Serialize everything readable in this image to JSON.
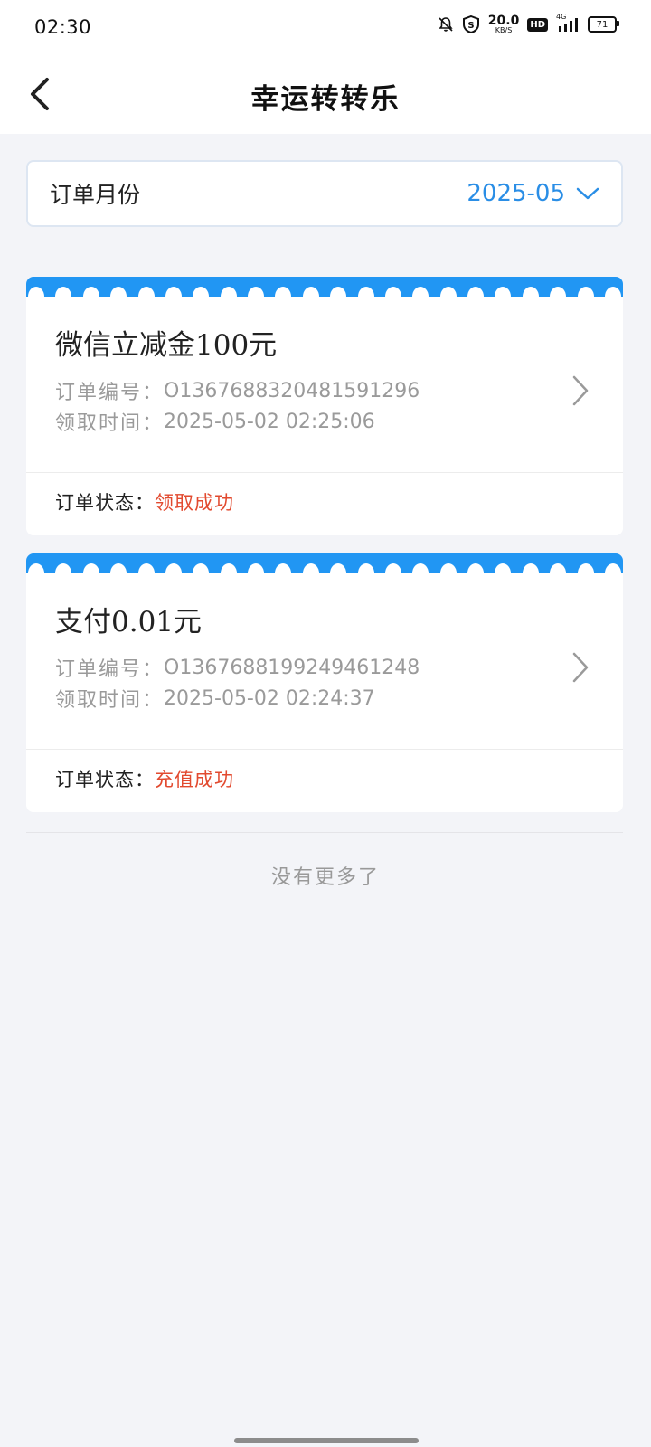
{
  "status_bar": {
    "time": "02:30",
    "net_speed_value": "20.0",
    "net_speed_unit": "KB/S",
    "hd_label": "HD",
    "network_label": "4G",
    "battery_level": "71",
    "icons": [
      "bell-off-icon",
      "shield-s-icon",
      "hd-icon",
      "signal-icon",
      "battery-icon"
    ]
  },
  "header": {
    "title": "幸运转转乐",
    "back_icon": "chevron-left-icon"
  },
  "month_filter": {
    "label": "订单月份",
    "value": "2025-05",
    "icon": "chevron-down-icon"
  },
  "orders": [
    {
      "title": "微信立减金100元",
      "order_no_label": "订单编号：",
      "order_no": "O1367688320481591296",
      "time_label": "领取时间：",
      "time": "2025-05-02 02:25:06",
      "status_label": "订单状态：",
      "status": "领取成功"
    },
    {
      "title": "支付0.01元",
      "order_no_label": "订单编号：",
      "order_no": "O1367688199249461248",
      "time_label": "领取时间：",
      "time": "2025-05-02 02:24:37",
      "status_label": "订单状态：",
      "status": "充值成功"
    }
  ],
  "list_end_text": "没有更多了",
  "colors": {
    "accent": "#2196f3",
    "month_value": "#2a8ee6",
    "status_success": "#e24a2f",
    "background": "#f3f4f8"
  }
}
